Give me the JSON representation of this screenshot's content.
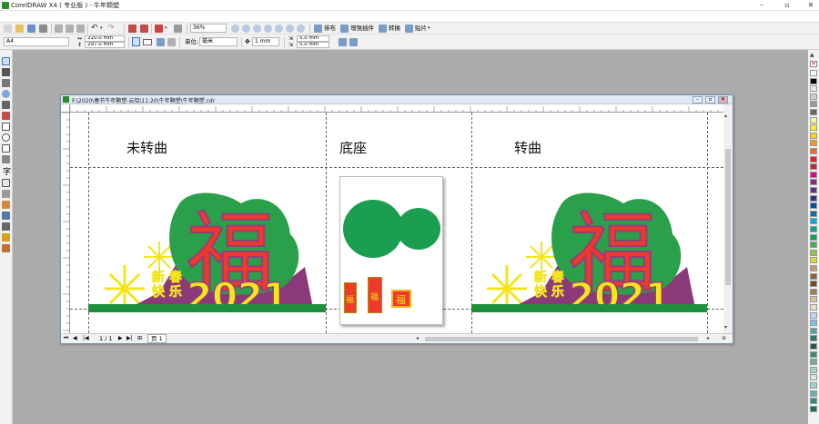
{
  "window": {
    "title": "CorelDRAW X4 ( 专业版 ) - 牛年颗塑"
  },
  "toolbar": {
    "zoom_value": "36%",
    "sort_label": "排布",
    "plugins_label": "增强插件",
    "convert_label": "转换",
    "paste_label": "贴片"
  },
  "property_bar": {
    "page_size": "A4",
    "width_value": "210.0 mm",
    "height_value": "297.0 mm",
    "units_label": "单位:",
    "units_value": "毫米",
    "nudge_value": "1 mm",
    "dup_x_value": "5.0 mm",
    "dup_y_value": "5.0 mm"
  },
  "document": {
    "title": "F:\\2020\\春节牛年颗塑-云铝\\11.20\\牛年颗塑\\牛年颗塑.cdr",
    "page_counter": "1 / 1",
    "page_tab": "页 1"
  },
  "canvas": {
    "label_left": "未转曲",
    "label_middle": "底座",
    "label_right": "转曲",
    "art_char": "福",
    "art_year": "2021",
    "art_slogan_top": "新 春",
    "art_slogan_bottom": "快 乐",
    "sticker_char": "福"
  },
  "colors": {
    "fu_red": "#ee3a2a",
    "fu_outline": "#9b3a7a",
    "year_yellow": "#f3e61a",
    "ground_green": "#1e8f3a",
    "circle_green": "#1b9e4f",
    "snow_yellow": "#f4e41c",
    "selection_blue": "#1a64d6"
  },
  "palette": [
    "#ffffff",
    "#000000",
    "#e6e6e6",
    "#cccccc",
    "#999999",
    "#666666",
    "#f8f3a0",
    "#fff200",
    "#ffd400",
    "#f7941d",
    "#f26522",
    "#ed1c24",
    "#c1272d",
    "#ec008c",
    "#92278f",
    "#662d91",
    "#2e3192",
    "#0054a6",
    "#0072bc",
    "#00aeef",
    "#00a99d",
    "#00a651",
    "#39b54a",
    "#8dc63f",
    "#d7df23",
    "#c69c6d",
    "#8c6239",
    "#754c24",
    "#a67c52",
    "#d4c19c",
    "#eadfc4",
    "#b3d9ff",
    "#80c0e0",
    "#4da6a6",
    "#2b7a6f",
    "#1e5b4f",
    "#3a8f6a",
    "#6fb08f",
    "#a6d3b9",
    "#d3e9dc",
    "#9fcfcf",
    "#5fb3a9",
    "#2f8f7f",
    "#1f6f60"
  ]
}
